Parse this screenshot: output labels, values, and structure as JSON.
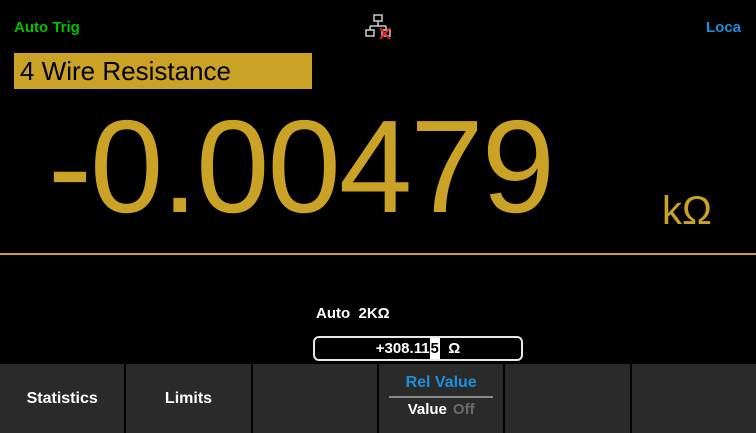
{
  "status": {
    "trigger": "Auto Trig",
    "remote": "Loca"
  },
  "function": "4 Wire Resistance",
  "reading": {
    "value": "-0.00479",
    "unit": "kΩ"
  },
  "range_label": "Auto  2KΩ",
  "rel_entry": {
    "prefix": "+308.11",
    "cursor_digit": "5",
    "suffix": "  Ω"
  },
  "softkeys": {
    "statistics": "Statistics",
    "limits": "Limits",
    "rel_title": "Rel Value",
    "rel_on": "Value",
    "rel_off": "Off"
  },
  "colors": {
    "accent": "#c9a226",
    "trigger": "#00c000",
    "remote": "#1e8fdc"
  }
}
